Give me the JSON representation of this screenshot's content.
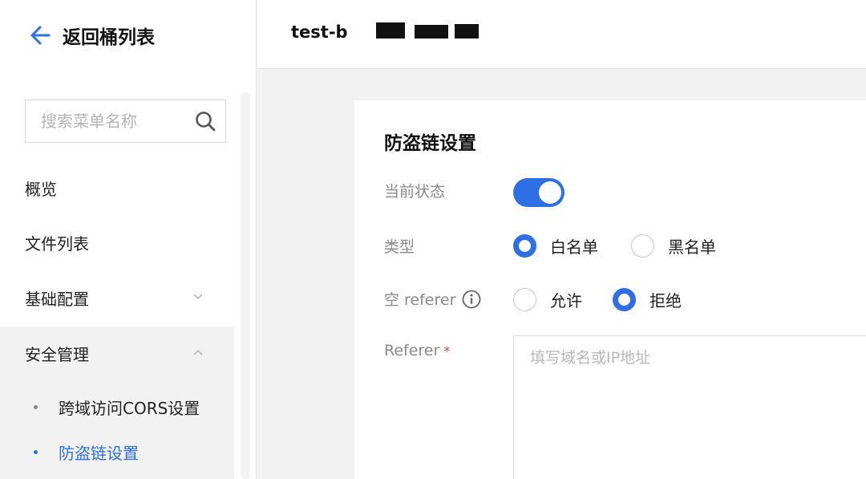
{
  "sidebar": {
    "back_label": "返回桶列表",
    "search_placeholder": "搜索菜单名称",
    "items": [
      {
        "label": "概览"
      },
      {
        "label": "文件列表"
      },
      {
        "label": "基础配置"
      },
      {
        "label": "安全管理"
      }
    ],
    "sub_items": [
      {
        "label": "跨域访问CORS设置"
      },
      {
        "label": "防盗链设置"
      }
    ]
  },
  "header": {
    "bucket_name": "test-b"
  },
  "panel": {
    "title": "防盗链设置",
    "status_label": "当前状态",
    "status_enabled": true,
    "type_label": "类型",
    "type_options": [
      "白名单",
      "黑名单"
    ],
    "type_selected": "白名单",
    "empty_referer_label": "空 referer",
    "empty_referer_options": [
      "允许",
      "拒绝"
    ],
    "empty_referer_selected": "拒绝",
    "referer_label": "Referer",
    "referer_required": "*",
    "referer_placeholder": "填写域名或IP地址"
  },
  "colors": {
    "accent": "#2f6fe6",
    "required": "#e54545"
  }
}
